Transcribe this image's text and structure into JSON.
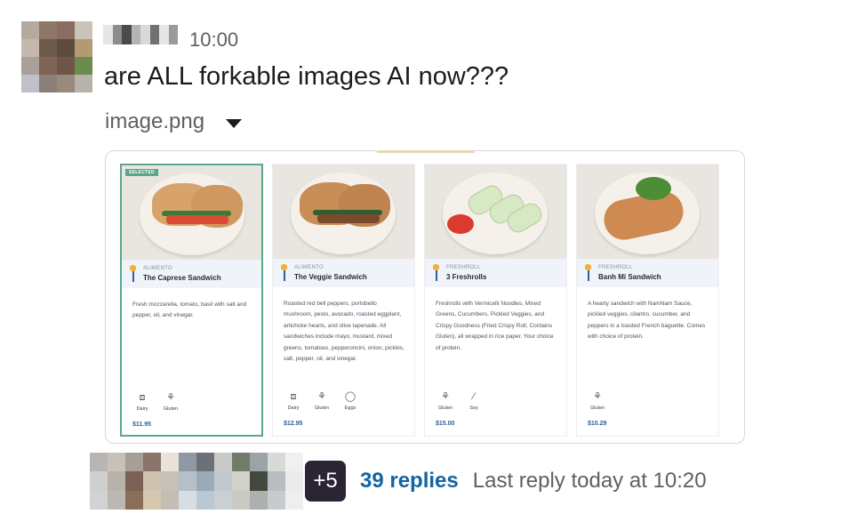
{
  "message": {
    "timestamp": "10:00",
    "text": "are ALL forkable images AI now???",
    "attachment": {
      "file_name": "image.png"
    }
  },
  "menu": {
    "cards": [
      {
        "selected": true,
        "selected_label": "SELECTED",
        "category": "ALIMENTO",
        "title": "The Caprese Sandwich",
        "description": "Fresh mozzarella, tomato, basil with salt and pepper, oil, and vinegar.",
        "allergens": [
          {
            "label": "Dairy",
            "icon": "milk-carton-icon"
          },
          {
            "label": "Gluten",
            "icon": "wheat-icon"
          }
        ],
        "price": "$11.95"
      },
      {
        "selected": false,
        "category": "ALIMENTO",
        "title": "The Veggie Sandwich",
        "description": "Roasted red bell peppers, portobello mushroom, pesto, avocado, roasted eggplant, artichoke hearts, and olive tapenade. All sandwiches include mayo, mustard, mixed greens, tomatoes, pepperoncini, onion, pickles, salt, pepper, oil, and vinegar.",
        "allergens": [
          {
            "label": "Dairy",
            "icon": "milk-carton-icon"
          },
          {
            "label": "Gluten",
            "icon": "wheat-icon"
          },
          {
            "label": "Eggs",
            "icon": "egg-icon"
          }
        ],
        "price": "$12.95"
      },
      {
        "selected": false,
        "category": "FRESHROLL",
        "title": "3 Freshrolls",
        "description": "Freshrolls with Vermicelli Noodles, Mixed Greens, Cucumbers, Pickled Veggies, and Crispy Goodness (Fried Crispy Roll, Contains Gluten), all wrapped in rice paper. Your choice of protein.",
        "allergens": [
          {
            "label": "Gluten",
            "icon": "wheat-icon"
          },
          {
            "label": "Soy",
            "icon": "soybean-icon"
          }
        ],
        "price": "$15.00"
      },
      {
        "selected": false,
        "category": "FRESHROLL",
        "title": "Banh Mi Sandwich",
        "description": "A hearty sandwich with NamNam Sauce, pickled veggies, cilantro, cucumber, and peppers in a toasted French baguette. Comes with choice of protein.",
        "allergens": [
          {
            "label": "Gluten",
            "icon": "wheat-icon"
          }
        ],
        "price": "$10.29"
      }
    ]
  },
  "thread": {
    "extra_participants": "+5",
    "replies_label": "39 replies",
    "last_reply": "Last reply today at 10:20"
  },
  "colors": {
    "link": "#1264a3",
    "selected_border": "#5aa88a",
    "price": "#2f5f9c",
    "text_primary": "#1d1c1d",
    "text_secondary": "#616061"
  }
}
